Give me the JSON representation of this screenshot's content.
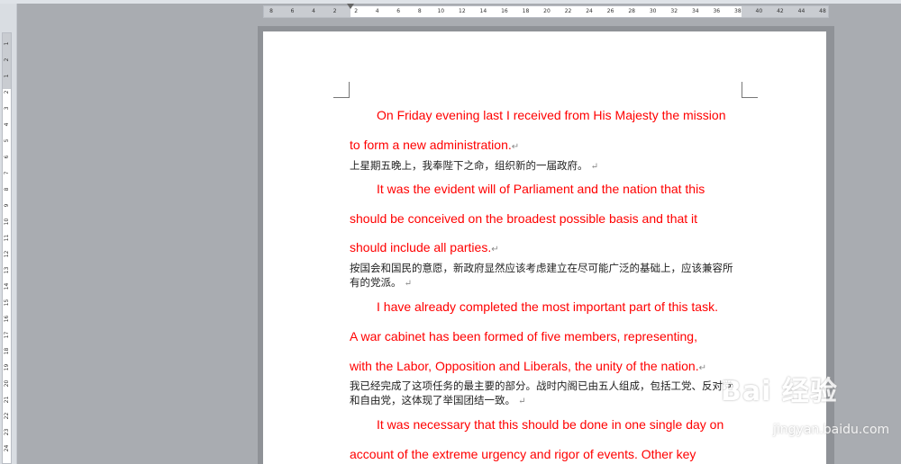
{
  "ruler": {
    "horizontal_ticks": [
      "8",
      "6",
      "4",
      "2",
      "2",
      "4",
      "6",
      "8",
      "10",
      "12",
      "14",
      "16",
      "18",
      "20",
      "22",
      "24",
      "26",
      "28",
      "30",
      "32",
      "34",
      "36",
      "38",
      "40",
      "42",
      "44",
      "48"
    ],
    "vertical_ticks": [
      "1",
      "2",
      "1",
      "2",
      "3",
      "4",
      "5",
      "6",
      "7",
      "8",
      "9",
      "10",
      "11",
      "12",
      "13",
      "14",
      "15",
      "16",
      "17",
      "18",
      "19",
      "20",
      "21",
      "22",
      "23",
      "24"
    ]
  },
  "document": {
    "lines": [
      {
        "text": "On Friday evening last I received from His Majesty the mission",
        "lang": "en",
        "indent": true
      },
      {
        "text": "to form a new administration.",
        "lang": "en",
        "indent": false
      },
      {
        "text": "上星期五晚上，我奉陛下之命，组织新的一届政府。",
        "lang": "cn"
      },
      {
        "text": "It was the evident will of Parliament and the nation that this",
        "lang": "en",
        "indent": true
      },
      {
        "text": "should be conceived on the broadest possible basis and that it",
        "lang": "en",
        "indent": false
      },
      {
        "text": "should include all parties.",
        "lang": "en",
        "indent": false
      },
      {
        "text": "按国会和国民的意愿，新政府显然应该考虑建立在尽可能广泛的基础上，应该兼容所有的党派。",
        "lang": "cn"
      },
      {
        "text": "I have already completed the most important part of this task.",
        "lang": "en",
        "indent": true
      },
      {
        "text": "A war cabinet has been formed of five members, representing,",
        "lang": "en",
        "indent": false
      },
      {
        "text": "with the Labor, Opposition and Liberals, the unity of the nation.",
        "lang": "en",
        "indent": false
      },
      {
        "text": "我已经完成了这项任务的最主要的部分。战时内阁已由五人组成，包括工党、反对党和自由党，这体现了举国团结一致。",
        "lang": "cn"
      },
      {
        "text": "It was necessary that this should be done in one single day on",
        "lang": "en",
        "indent": true
      },
      {
        "text": "account of the extreme urgency and rigor of events. Other key",
        "lang": "en",
        "indent": false
      }
    ]
  },
  "watermark": {
    "logo_text": "Bai 经验",
    "url": "jingyan.baidu.com"
  },
  "colors": {
    "english_text": "#ff0000",
    "chinese_text": "#222222",
    "workspace": "#a9acb1"
  }
}
